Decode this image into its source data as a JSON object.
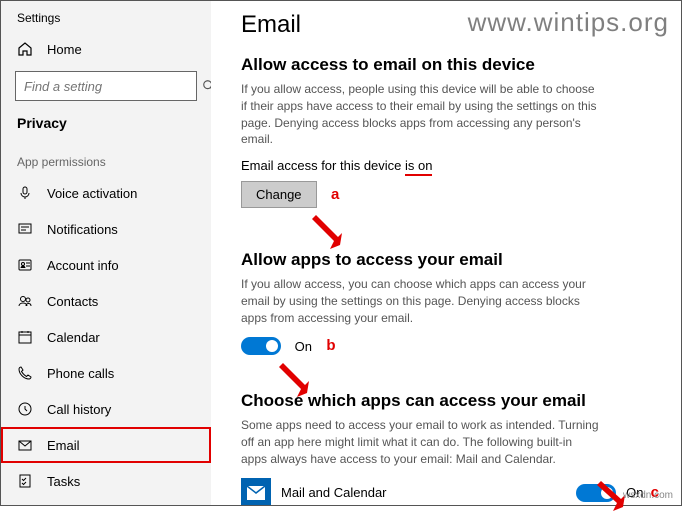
{
  "window_title": "Settings",
  "watermark_top": "www.wintips.org",
  "watermark_bottom": "wsxdn.com",
  "sidebar": {
    "home": "Home",
    "search_placeholder": "Find a setting",
    "section": "Privacy",
    "permissions_header": "App permissions",
    "items": [
      {
        "label": "Voice activation"
      },
      {
        "label": "Notifications"
      },
      {
        "label": "Account info"
      },
      {
        "label": "Contacts"
      },
      {
        "label": "Calendar"
      },
      {
        "label": "Phone calls"
      },
      {
        "label": "Call history"
      },
      {
        "label": "Email"
      },
      {
        "label": "Tasks"
      }
    ]
  },
  "main": {
    "title": "Email",
    "section1": {
      "heading": "Allow access to email on this device",
      "body": "If you allow access, people using this device will be able to choose if their apps have access to their email by using the settings on this page. Denying access blocks apps from accessing any person's email.",
      "status_prefix": "Email access for this device ",
      "status_value": "is on",
      "button": "Change",
      "callout": "a"
    },
    "section2": {
      "heading": "Allow apps to access your email",
      "body": "If you allow access, you can choose which apps can access your email by using the settings on this page. Denying access blocks apps from accessing your email.",
      "toggle_label": "On",
      "callout": "b"
    },
    "section3": {
      "heading": "Choose which apps can access your email",
      "body": "Some apps need to access your email to work as intended. Turning off an app here might limit what it can do. The following built-in apps always have access to your email: Mail and Calendar.",
      "app_name": "Mail and Calendar",
      "app_toggle_label": "On",
      "callout": "c"
    }
  }
}
